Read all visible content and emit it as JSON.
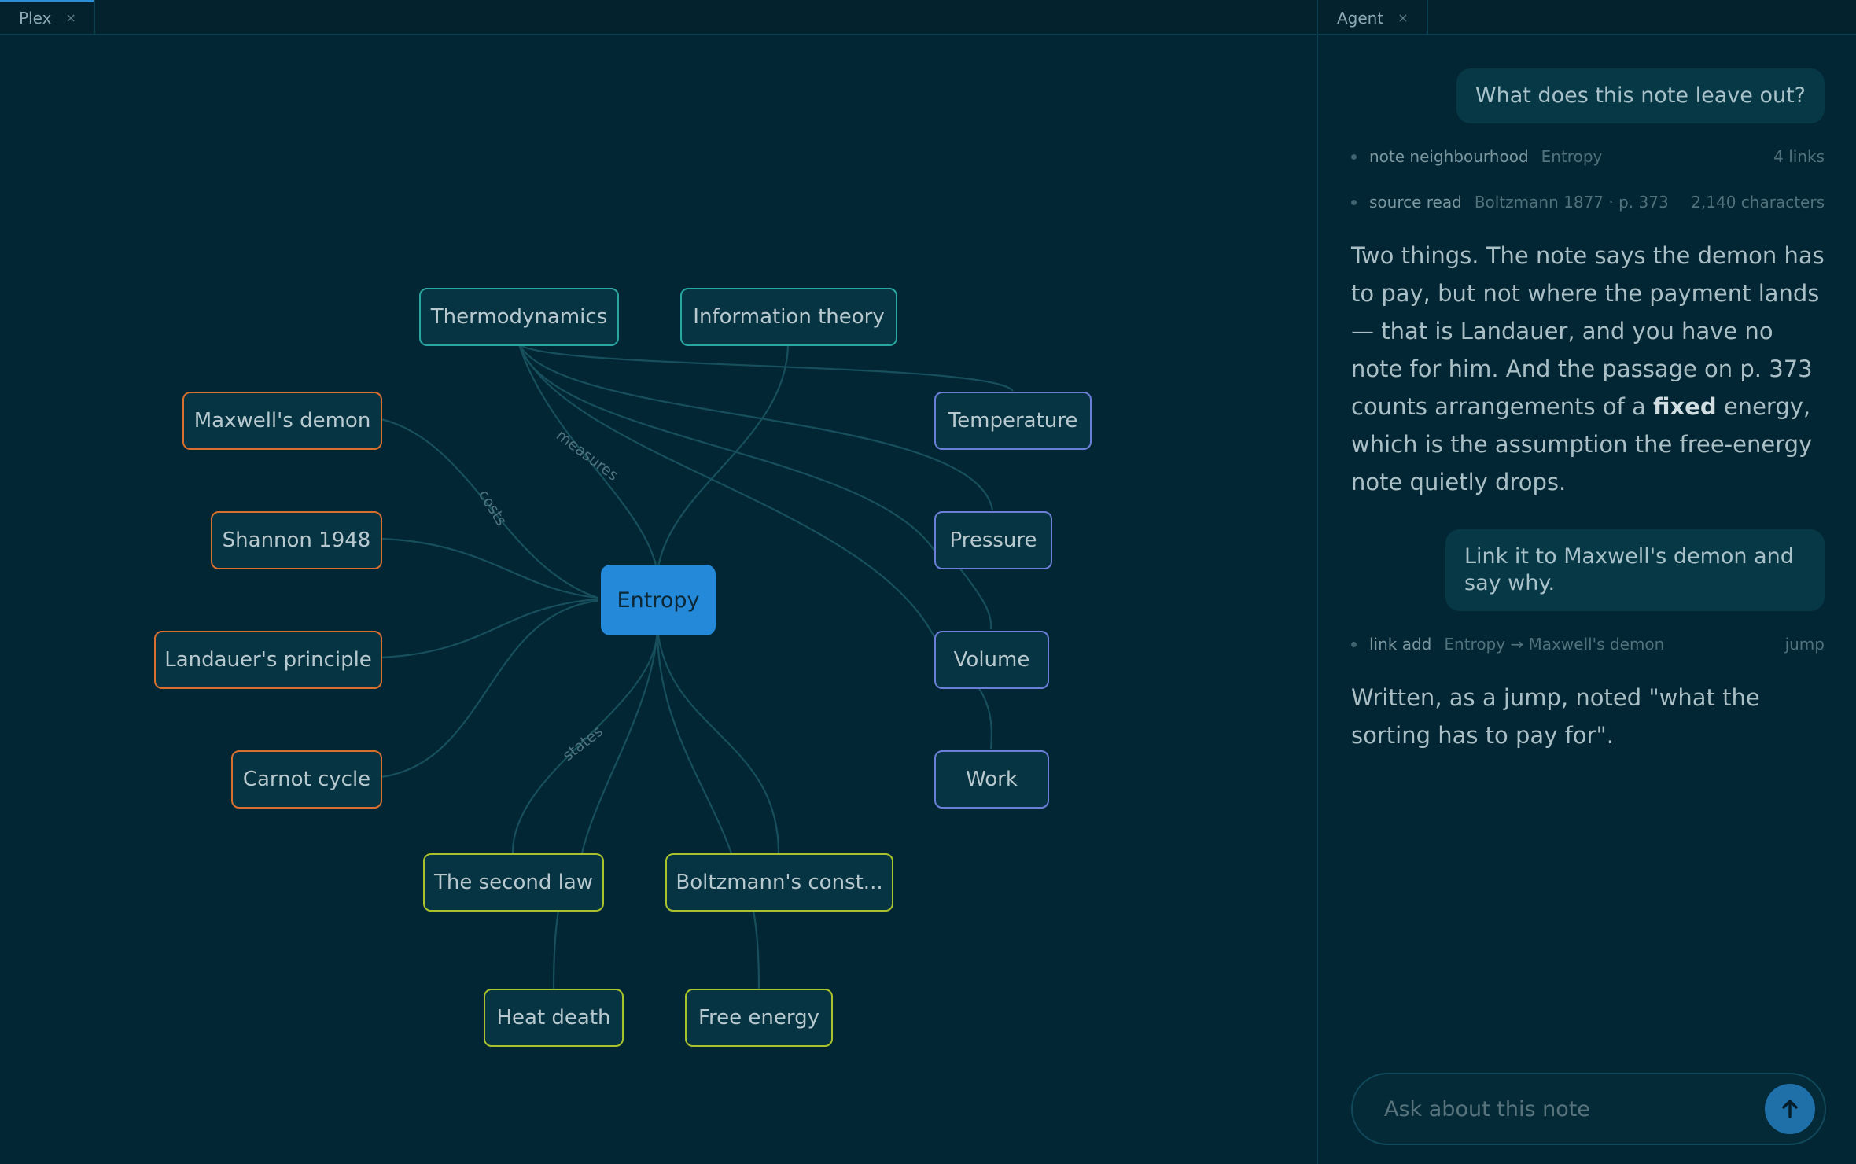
{
  "left_pane": {
    "tab": {
      "label": "Plex",
      "close": "×"
    }
  },
  "graph": {
    "center": "Entropy",
    "nodes": {
      "thermodynamics": "Thermodynamics",
      "information_theory": "Information theory",
      "maxwells_demon": "Maxwell's demon",
      "shannon_1948": "Shannon 1948",
      "landauers_principle": "Landauer's principle",
      "carnot_cycle": "Carnot cycle",
      "temperature": "Temperature",
      "pressure": "Pressure",
      "volume": "Volume",
      "work": "Work",
      "second_law": "The second law",
      "boltzmann_const": "Boltzmann's const...",
      "heat_death": "Heat death",
      "free_energy": "Free energy"
    },
    "edge_labels": {
      "measures": "measures",
      "costs": "costs",
      "states": "states"
    },
    "colors": {
      "center": "#2389d8",
      "teal": "#2aa6a0",
      "orange": "#d7702f",
      "violet": "#6b7fd8",
      "lime": "#a9c22c"
    }
  },
  "right_pane": {
    "tab": {
      "label": "Agent",
      "close": "×"
    },
    "messages": {
      "user_1": "What does this note leave out?",
      "tool_1": {
        "name": "note neighbourhood",
        "arg": "Entropy",
        "result": "4 links"
      },
      "tool_2": {
        "name": "source read",
        "arg": "Boltzmann 1877 · p. 373",
        "result": "2,140 characters"
      },
      "answer_1": {
        "before": "Two things. The note says the demon has to pay, but not where the payment lands — that is Landauer, and you have no note for him. And the passage on p. 373 counts arrangements of a ",
        "bold": "fixed",
        "after": " energy, which is the assumption the free-energy note quietly drops."
      },
      "user_2": "Link it to Maxwell's demon and say why.",
      "tool_3": {
        "name": "link add",
        "arg": "Entropy → Maxwell's demon",
        "result": "jump"
      },
      "answer_2": "Written, as a jump, noted \"what the sorting has to pay for\"."
    },
    "composer": {
      "placeholder": "Ask about this note",
      "send_icon": "arrow-up-icon"
    }
  }
}
